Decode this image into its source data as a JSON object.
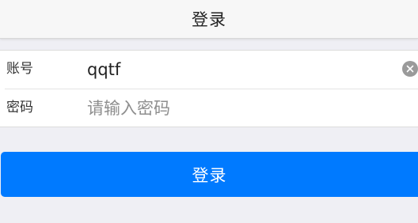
{
  "header": {
    "title": "登录"
  },
  "form": {
    "account": {
      "label": "账号",
      "value": "qqtf",
      "clear_icon": "clear-circle-icon"
    },
    "password": {
      "label": "密码",
      "value": "",
      "placeholder": "请输入密码"
    }
  },
  "actions": {
    "login_label": "登录"
  },
  "colors": {
    "primary": "#007aff",
    "background": "#efeff4",
    "nav_background": "#f7f7f7"
  }
}
